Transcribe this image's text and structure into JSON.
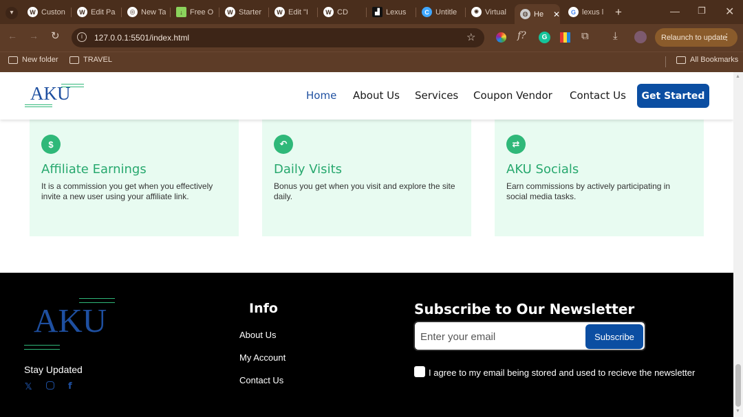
{
  "browser": {
    "tabs": [
      {
        "label": "Custon",
        "icon": "wordpress-icon",
        "color": "#ffffff"
      },
      {
        "label": "Edit Pa",
        "icon": "wordpress-icon",
        "color": "#ffffff"
      },
      {
        "label": "New Ta",
        "icon": "chrome-icon",
        "color": "#ffffff"
      },
      {
        "label": "Free O",
        "icon": "download-icon",
        "color": "#8bd35c"
      },
      {
        "label": "Starter",
        "icon": "wordpress-icon",
        "color": "#ffffff"
      },
      {
        "label": "Edit \"I",
        "icon": "wordpress-icon",
        "color": "#ffffff"
      },
      {
        "label": "CD",
        "icon": "wordpress-icon",
        "color": "#ffffff"
      },
      {
        "label": "Lexus",
        "icon": "lexus-icon",
        "color": "#111111"
      },
      {
        "label": "Untitle",
        "icon": "canva-icon",
        "color": "#3fa7ff"
      },
      {
        "label": "Virtual",
        "icon": "openai-icon",
        "color": "#ffffff"
      },
      {
        "label": "He",
        "icon": "globe-icon",
        "color": "#cccccc"
      },
      {
        "label": "lexus l",
        "icon": "google-icon",
        "color": "#ffffff"
      }
    ],
    "url": "127.0.0.1:5501/index.html",
    "relaunch_label": "Relaunch to update",
    "bookmarks": [
      "New folder",
      "TRAVEL"
    ],
    "all_bookmarks_label": "All Bookmarks"
  },
  "site": {
    "logo_text": "AKU",
    "nav": {
      "links": [
        "Home",
        "About Us",
        "Services",
        "Coupon Vendor",
        "Contact Us"
      ],
      "cta_label": "Get Started"
    },
    "cards": [
      {
        "icon": "dollar-icon",
        "title": "Affiliate Earnings",
        "description": "It is a commission you get when you effectively invite a new user using your affiliate link."
      },
      {
        "icon": "return-arrow-icon",
        "title": "Daily Visits",
        "description": "Bonus you get when you visit and explore the site daily."
      },
      {
        "icon": "share-icon",
        "title": "AKU Socials",
        "description": "Earn commissions by actively participating in social media tasks."
      }
    ],
    "footer": {
      "logo_text": "AKU",
      "stay_updated": "Stay Updated",
      "socials": [
        "x-icon",
        "instagram-icon",
        "facebook-icon"
      ],
      "info_heading": "Info",
      "info_links": [
        "About Us",
        "My Account",
        "Contact Us"
      ],
      "newsletter_heading": "Subscribe to Our Newsletter",
      "email_placeholder": "Enter your email",
      "subscribe_label": "Subscribe",
      "agree_text": "I agree to my email being stored and used to recieve the newsletter"
    },
    "colors": {
      "brand_blue": "#0b4ea2",
      "card_green": "#27a86e",
      "card_bg": "#e8fbf1"
    }
  }
}
